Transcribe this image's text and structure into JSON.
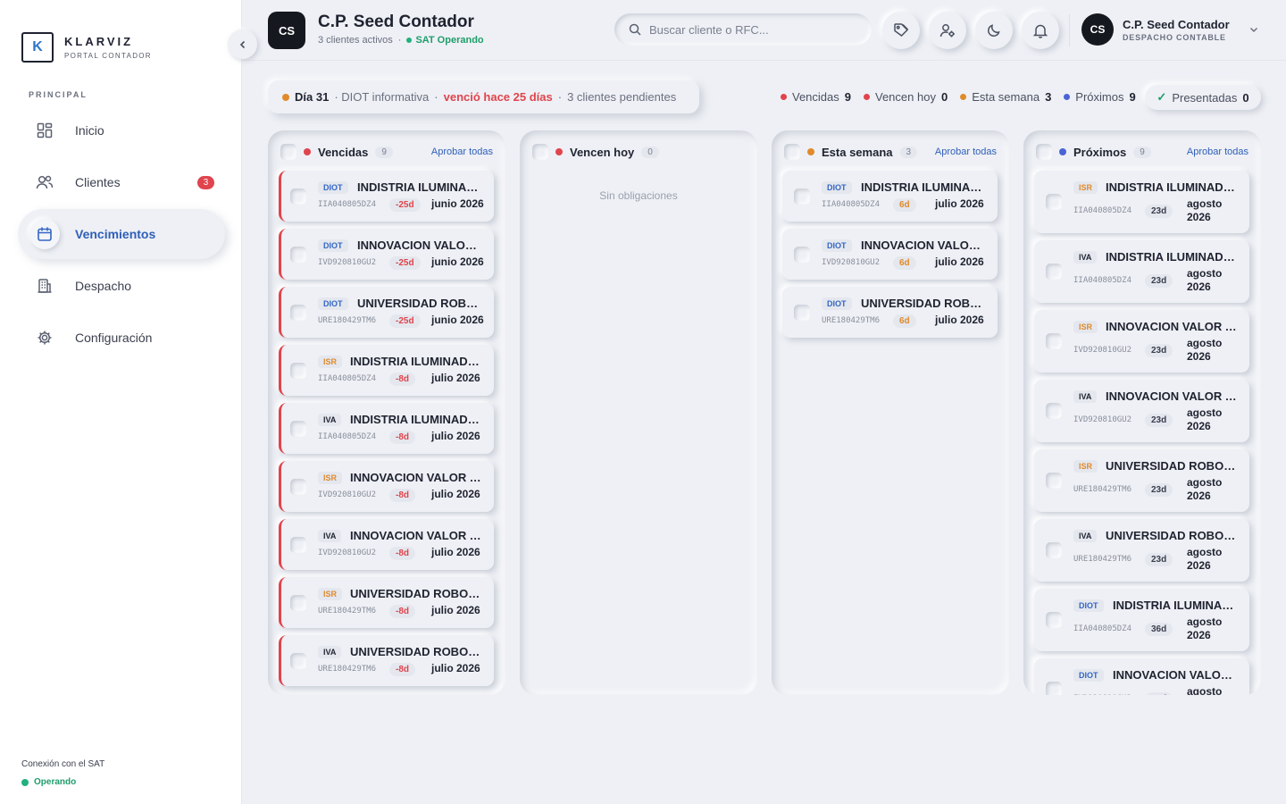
{
  "sidebar": {
    "brand": "KLARVIZ",
    "brand_sub": "PORTAL CONTADOR",
    "logo_letter": "K",
    "section_label": "PRINCIPAL",
    "items": [
      {
        "label": "Inicio",
        "icon": "grid-icon"
      },
      {
        "label": "Clientes",
        "icon": "users-icon",
        "badge": "3"
      },
      {
        "label": "Vencimientos",
        "icon": "calendar-icon",
        "active": true
      },
      {
        "label": "Despacho",
        "icon": "building-icon"
      },
      {
        "label": "Configuración",
        "icon": "gear-icon"
      }
    ],
    "sat_label": "Conexión con el SAT",
    "sat_status": "Operando"
  },
  "header": {
    "initials": "CS",
    "title": "C.P. Seed Contador",
    "clients_active": "3 clientes activos",
    "separator": "·",
    "sat_status": "SAT Operando",
    "search_placeholder": "Buscar cliente o RFC...",
    "user_initials": "CS",
    "user_name": "C.P. Seed Contador",
    "user_role": "DESPACHO CONTABLE"
  },
  "infobar": {
    "day": "Día 31",
    "obligation": "· DIOT informativa",
    "sep": "·",
    "overdue_text": "venció hace 25 días",
    "pending": "3 clientes pendientes"
  },
  "stats": [
    {
      "label": "Vencidas",
      "value": "9",
      "color": "#e0444c"
    },
    {
      "label": "Vencen hoy",
      "value": "0",
      "color": "#e0444c"
    },
    {
      "label": "Esta semana",
      "value": "3",
      "color": "#e08a2c"
    },
    {
      "label": "Próximos",
      "value": "9",
      "color": "#4a64d6"
    }
  ],
  "presentadas": {
    "check": "✓",
    "label": "Presentadas",
    "value": "0"
  },
  "columns": {
    "vencidas": {
      "title": "Vencidas",
      "count": "9",
      "approve": "Aprobar todas",
      "color": "#e0444c",
      "cards": [
        {
          "tag": "DIOT",
          "client": "INDISTRIA ILUMINADORA",
          "rfc": "IIA040805DZ4",
          "days": "-25d",
          "period": "junio 2026"
        },
        {
          "tag": "DIOT",
          "client": "INNOVACION VALOR Y SERVICIOS",
          "rfc": "IVD920810GU2",
          "days": "-25d",
          "period": "junio 2026"
        },
        {
          "tag": "DIOT",
          "client": "UNIVERSIDAD ROBOTICA",
          "rfc": "URE180429TM6",
          "days": "-25d",
          "period": "junio 2026"
        },
        {
          "tag": "ISR",
          "client": "INDISTRIA ILUMINADORA",
          "rfc": "IIA040805DZ4",
          "days": "-8d",
          "period": "julio 2026"
        },
        {
          "tag": "IVA",
          "client": "INDISTRIA ILUMINADORA",
          "rfc": "IIA040805DZ4",
          "days": "-8d",
          "period": "julio 2026"
        },
        {
          "tag": "ISR",
          "client": "INNOVACION VALOR Y SERVICIOS",
          "rfc": "IVD920810GU2",
          "days": "-8d",
          "period": "julio 2026"
        },
        {
          "tag": "IVA",
          "client": "INNOVACION VALOR Y SERVICIOS",
          "rfc": "IVD920810GU2",
          "days": "-8d",
          "period": "julio 2026"
        },
        {
          "tag": "ISR",
          "client": "UNIVERSIDAD ROBOTICA",
          "rfc": "URE180429TM6",
          "days": "-8d",
          "period": "julio 2026"
        },
        {
          "tag": "IVA",
          "client": "UNIVERSIDAD ROBOTICA",
          "rfc": "URE180429TM6",
          "days": "-8d",
          "period": "julio 2026"
        }
      ]
    },
    "hoy": {
      "title": "Vencen hoy",
      "count": "0",
      "color": "#e0444c",
      "empty": "Sin obligaciones"
    },
    "semana": {
      "title": "Esta semana",
      "count": "3",
      "approve": "Aprobar todas",
      "color": "#e08a2c",
      "cards": [
        {
          "tag": "DIOT",
          "client": "INDISTRIA ILUMINADORA",
          "rfc": "IIA040805DZ4",
          "days": "6d",
          "period": "julio 2026"
        },
        {
          "tag": "DIOT",
          "client": "INNOVACION VALOR Y SERVICIOS",
          "rfc": "IVD920810GU2",
          "days": "6d",
          "period": "julio 2026"
        },
        {
          "tag": "DIOT",
          "client": "UNIVERSIDAD ROBOTICA",
          "rfc": "URE180429TM6",
          "days": "6d",
          "period": "julio 2026"
        }
      ]
    },
    "proximos": {
      "title": "Próximos",
      "count": "9",
      "approve": "Aprobar todas",
      "color": "#4a64d6",
      "cards": [
        {
          "tag": "ISR",
          "client": "INDISTRIA ILUMINADORA",
          "rfc": "IIA040805DZ4",
          "days": "23d",
          "period": "agosto 2026"
        },
        {
          "tag": "IVA",
          "client": "INDISTRIA ILUMINADORA",
          "rfc": "IIA040805DZ4",
          "days": "23d",
          "period": "agosto 2026"
        },
        {
          "tag": "ISR",
          "client": "INNOVACION VALOR Y SERVICIOS",
          "rfc": "IVD920810GU2",
          "days": "23d",
          "period": "agosto 2026"
        },
        {
          "tag": "IVA",
          "client": "INNOVACION VALOR Y SERVICIOS",
          "rfc": "IVD920810GU2",
          "days": "23d",
          "period": "agosto 2026"
        },
        {
          "tag": "ISR",
          "client": "UNIVERSIDAD ROBOTICA",
          "rfc": "URE180429TM6",
          "days": "23d",
          "period": "agosto 2026"
        },
        {
          "tag": "IVA",
          "client": "UNIVERSIDAD ROBOTICA",
          "rfc": "URE180429TM6",
          "days": "23d",
          "period": "agosto 2026"
        },
        {
          "tag": "DIOT",
          "client": "INDISTRIA ILUMINADORA",
          "rfc": "IIA040805DZ4",
          "days": "36d",
          "period": "agosto 2026"
        },
        {
          "tag": "DIOT",
          "client": "INNOVACION VALOR Y SERVICIOS",
          "rfc": "IVD920810GU2",
          "days": "36d",
          "period": "agosto 2026"
        }
      ]
    }
  }
}
